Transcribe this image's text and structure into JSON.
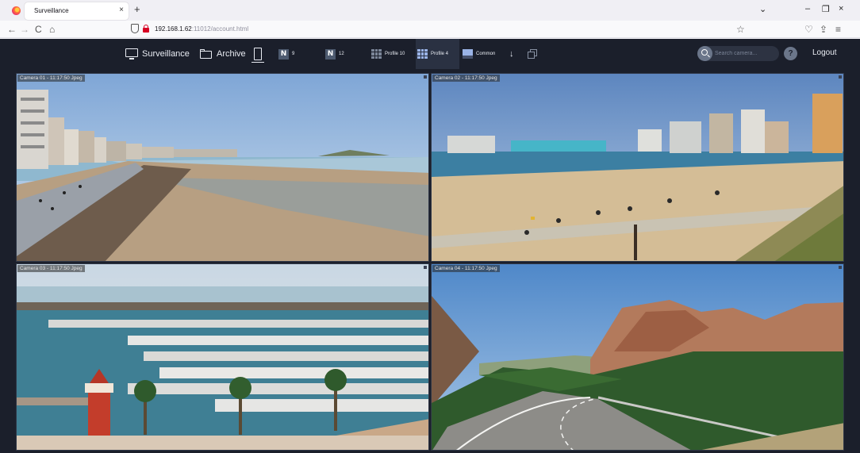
{
  "browser": {
    "tab_title": "Surveillance",
    "tab_close": "×",
    "new_tab": "+",
    "url_host": "192.168.1.62",
    "url_path": ":11012/account.html",
    "nav_back": "←",
    "nav_forward": "→",
    "nav_reload": "C",
    "nav_home": "⌂",
    "list_all_tabs": "⌄",
    "minimize": "–",
    "restore": "❐",
    "close": "×",
    "bookmark": "☆",
    "pocket": "♡",
    "extensions": "⇪",
    "menu": "≡"
  },
  "toolbar": {
    "surveillance": "Surveillance",
    "archive": "Archive",
    "layout_9_letter": "N",
    "layout_9": "9",
    "layout_12_letter": "N",
    "layout_12": "12",
    "profile_10": "Profile 10",
    "profile_4": "Profile 4",
    "common": "Common",
    "download": "↓",
    "search_placeholder": "Search camera...",
    "help": "?",
    "logout": "Logout"
  },
  "cameras": [
    {
      "label": "Camera 01 - 11:17:50 Jpeg"
    },
    {
      "label": "Camera 02 - 11:17:50 Jpeg"
    },
    {
      "label": "Camera 03 - 11:17:50 Jpeg"
    },
    {
      "label": "Camera 04 - 11:17:50 Jpeg"
    }
  ],
  "colors": {
    "toolbar_bg": "#1b1f2b",
    "accent": "#9ab3e6"
  }
}
